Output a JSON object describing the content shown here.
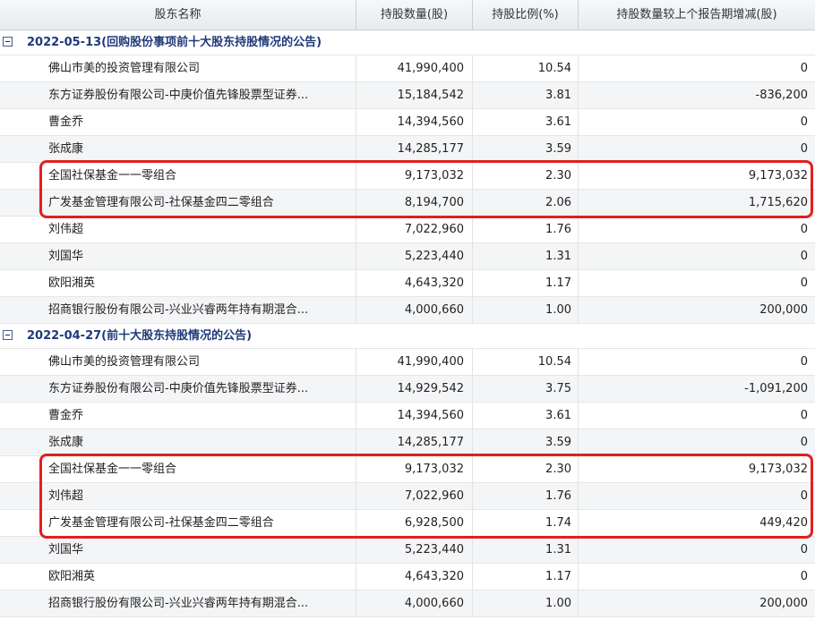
{
  "columns": {
    "name": "股东名称",
    "shares": "持股数量(股)",
    "ratio": "持股比例(%)",
    "change": "持股数量较上个报告期增减(股)"
  },
  "groups": [
    {
      "title": "2022-05-13(回购股份事项前十大股东持股情况的公告)",
      "rows": [
        {
          "name": "佛山市美的投资管理有限公司",
          "shares": "41,990,400",
          "ratio": "10.54",
          "change": "0"
        },
        {
          "name": "东方证券股份有限公司-中庚价值先锋股票型证券...",
          "shares": "15,184,542",
          "ratio": "3.81",
          "change": "-836,200"
        },
        {
          "name": "曹金乔",
          "shares": "14,394,560",
          "ratio": "3.61",
          "change": "0"
        },
        {
          "name": "张成康",
          "shares": "14,285,177",
          "ratio": "3.59",
          "change": "0"
        },
        {
          "name": "全国社保基金一一零组合",
          "shares": "9,173,032",
          "ratio": "2.30",
          "change": "9,173,032"
        },
        {
          "name": "广发基金管理有限公司-社保基金四二零组合",
          "shares": "8,194,700",
          "ratio": "2.06",
          "change": "1,715,620"
        },
        {
          "name": "刘伟超",
          "shares": "7,022,960",
          "ratio": "1.76",
          "change": "0"
        },
        {
          "name": "刘国华",
          "shares": "5,223,440",
          "ratio": "1.31",
          "change": "0"
        },
        {
          "name": "欧阳湘英",
          "shares": "4,643,320",
          "ratio": "1.17",
          "change": "0"
        },
        {
          "name": "招商银行股份有限公司-兴业兴睿两年持有期混合...",
          "shares": "4,000,660",
          "ratio": "1.00",
          "change": "200,000"
        }
      ]
    },
    {
      "title": "2022-04-27(前十大股东持股情况的公告)",
      "rows": [
        {
          "name": "佛山市美的投资管理有限公司",
          "shares": "41,990,400",
          "ratio": "10.54",
          "change": "0"
        },
        {
          "name": "东方证券股份有限公司-中庚价值先锋股票型证券...",
          "shares": "14,929,542",
          "ratio": "3.75",
          "change": "-1,091,200"
        },
        {
          "name": "曹金乔",
          "shares": "14,394,560",
          "ratio": "3.61",
          "change": "0"
        },
        {
          "name": "张成康",
          "shares": "14,285,177",
          "ratio": "3.59",
          "change": "0"
        },
        {
          "name": "全国社保基金一一零组合",
          "shares": "9,173,032",
          "ratio": "2.30",
          "change": "9,173,032"
        },
        {
          "name": "刘伟超",
          "shares": "7,022,960",
          "ratio": "1.76",
          "change": "0"
        },
        {
          "name": "广发基金管理有限公司-社保基金四二零组合",
          "shares": "6,928,500",
          "ratio": "1.74",
          "change": "449,420"
        },
        {
          "name": "刘国华",
          "shares": "5,223,440",
          "ratio": "1.31",
          "change": "0"
        },
        {
          "name": "欧阳湘英",
          "shares": "4,643,320",
          "ratio": "1.17",
          "change": "0"
        },
        {
          "name": "招商银行股份有限公司-兴业兴睿两年持有期混合...",
          "shares": "4,000,660",
          "ratio": "1.00",
          "change": "200,000"
        }
      ]
    }
  ],
  "colors": {
    "highlight_border": "#e02020",
    "group_title": "#1f3a7a",
    "alt_row": "#f4f5f7"
  }
}
